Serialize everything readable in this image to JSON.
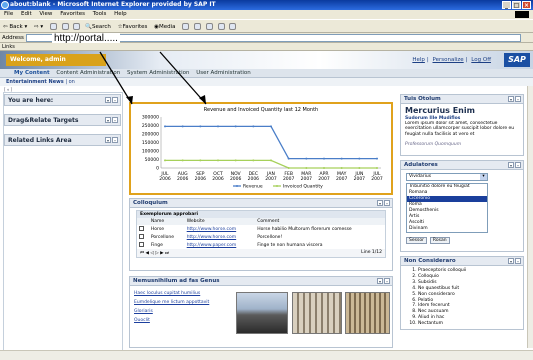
{
  "browser": {
    "title": "about:blank - Microsoft Internet Explorer provided by SAP IT",
    "menu": [
      "File",
      "Edit",
      "View",
      "Favorites",
      "Tools",
      "Help"
    ],
    "toolbar": {
      "back": "Back",
      "search": "Search",
      "favorites": "Favorites",
      "media": "Media"
    },
    "address_label": "Address",
    "url": "http://portal.....",
    "links_label": "Links"
  },
  "portal": {
    "welcome": "Welcome, admin",
    "header_links": [
      "Help",
      "Personalize",
      "Log Off"
    ],
    "logo": "SAP",
    "tabs": [
      "My Content",
      "Content Administration",
      "System Administration",
      "User Administration"
    ],
    "subtabs": [
      "Entertainment News",
      "on"
    ],
    "history": "[ « ]"
  },
  "left": {
    "boxes": [
      {
        "label": "You are here:"
      },
      {
        "label": "Drag&Relate Targets"
      },
      {
        "label": "Related Links Area"
      }
    ]
  },
  "chart_data": {
    "type": "line",
    "title": "Revenue and Invoiced Quantity last 12 Month",
    "categories": [
      "JUL 2006",
      "AUG 2006",
      "SEP 2006",
      "OCT 2006",
      "NOV 2006",
      "DEC 2006",
      "JAN 2007",
      "FEB 2007",
      "MAR 2007",
      "APR 2007",
      "MAY 2007",
      "JUN 2007",
      "JUL 2007"
    ],
    "yticks": [
      "300000",
      "250000",
      "200000",
      "150000",
      "100000",
      "50000",
      "0"
    ],
    "ylim": [
      0,
      300000
    ],
    "series": [
      {
        "name": "Revenue",
        "color": "#4a7ec8",
        "values": [
          245000,
          245000,
          245000,
          245000,
          245000,
          245000,
          245000,
          55000,
          55000,
          55000,
          55000,
          55000,
          55000
        ]
      },
      {
        "name": "Invoiced Quantity",
        "color": "#a6d05a",
        "values": [
          45000,
          45000,
          45000,
          45000,
          45000,
          45000,
          45000,
          0,
          0,
          0,
          0,
          0,
          0
        ]
      }
    ],
    "legend": "bottom"
  },
  "colloquium": {
    "title": "Colloquium",
    "group": "Exemplorum approbari",
    "columns": [
      "Name",
      "Website",
      "Comment"
    ],
    "rows": [
      {
        "name": "Horse",
        "site": "http://www.horse.com",
        "comment": "Horse habilio Multorum florerum comesse"
      },
      {
        "name": "Porcellone",
        "site": "http://www.horse.com",
        "comment": "Porcellone!"
      },
      {
        "name": "Finge",
        "site": "http://www.paper.com",
        "comment": "Finge te non humana viscera"
      }
    ],
    "pager": "Line 1/12"
  },
  "news": {
    "title": "Nemusnihilum ad fas Genus",
    "links": [
      "Haec loculus cupitat humilius",
      "Eumdelique me lictum appottavit",
      "Gloriaris",
      "Ouoclit"
    ]
  },
  "tuis": {
    "title": "Tuis Otolum",
    "heading": "Mercurius Enim",
    "subheading": "Sudorum Ille Mudiflos",
    "body": "Lorem ipsum dolor sit amet, consectetue exercitation ullamcorper suscipit lobor dolore eu feugiat nulla facilisis at vero et",
    "footer": "Professorum Quomquum"
  },
  "adulatores": {
    "title": "Adulatores",
    "select": "Vividarius",
    "options": [
      "Tribunitio dolore eu feugiat",
      "Romana",
      "Ciceronio",
      "Roma",
      "Demosthenis",
      "Artis",
      "Ascolti",
      "Divinam"
    ],
    "selected": 2,
    "buttons": [
      "Sessor",
      "Rosan"
    ]
  },
  "consider": {
    "title": "Non Consideraro",
    "items": [
      "Praeceptoris colloquii",
      "Colloquio",
      "Subsidis",
      "Ne quaestibus fuit",
      "Non consideraro",
      "Pelatio",
      "Idem fecerunt",
      "Nec aucsuam",
      "Aliud in hac",
      "Nectantum"
    ]
  }
}
